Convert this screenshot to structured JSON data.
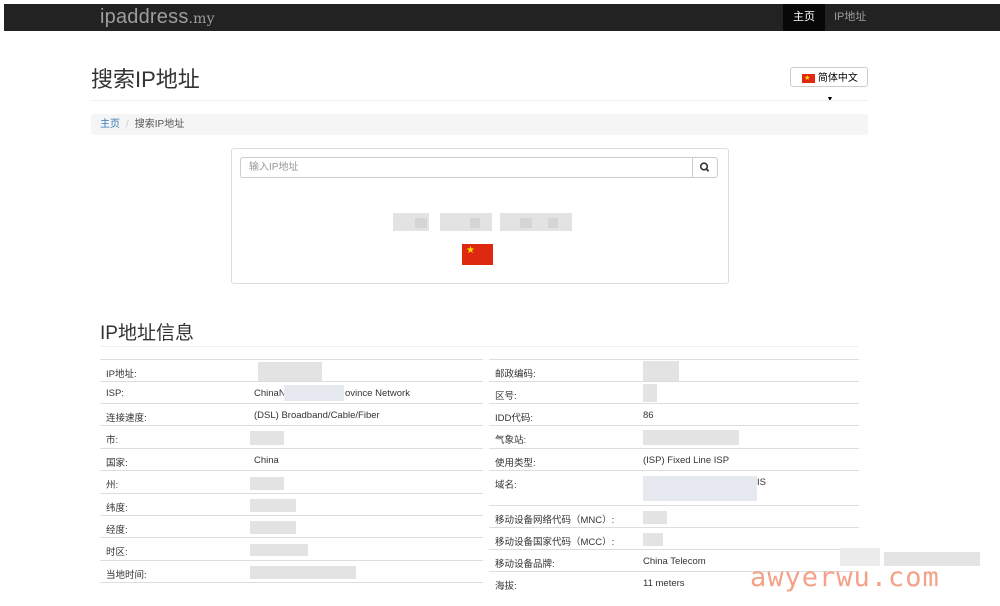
{
  "navbar": {
    "brand_name": "ipaddress",
    "brand_tld": ".my",
    "items": [
      {
        "label": "主页",
        "active": true
      },
      {
        "label": "IP地址",
        "active": false
      }
    ]
  },
  "page": {
    "title": "搜索IP地址",
    "language_button": "简体中文"
  },
  "breadcrumb": {
    "home": "主页",
    "separator": "/",
    "current": "搜索IP地址"
  },
  "search": {
    "placeholder": "输入IP地址",
    "button_icon": "search-icon"
  },
  "result": {
    "country_flag": "china-flag"
  },
  "info": {
    "title": "IP地址信息",
    "left": [
      {
        "label": "IP地址:",
        "value": ""
      },
      {
        "label": "ISP:",
        "value_start": "ChinaN",
        "value_end": "ovince Network"
      },
      {
        "label": "连接速度:",
        "value": "(DSL) Broadband/Cable/Fiber"
      },
      {
        "label": "市:",
        "value": ""
      },
      {
        "label": "国家:",
        "value": "China"
      },
      {
        "label": "州:",
        "value": ""
      },
      {
        "label": "纬度:",
        "value": ""
      },
      {
        "label": "经度:",
        "value": ""
      },
      {
        "label": "时区:",
        "value": ""
      },
      {
        "label": "当地时间:",
        "value": ""
      },
      {
        "label": "",
        "value": ""
      }
    ],
    "right": [
      {
        "label": "邮政编码:",
        "value": ""
      },
      {
        "label": "区号:",
        "value": ""
      },
      {
        "label": "IDD代码:",
        "value": "86"
      },
      {
        "label": "气象站:",
        "value": ""
      },
      {
        "label": "使用类型:",
        "value": "(ISP) Fixed Line ISP"
      },
      {
        "label": "域名:",
        "value_end": "IS"
      },
      {
        "label": "移动设备网络代码（MNC）:",
        "value": ""
      },
      {
        "label": "移动设备国家代码（MCC）:",
        "value": ""
      },
      {
        "label": "移动设备品牌:",
        "value": "China Telecom"
      },
      {
        "label": "海拔:",
        "value": "11 meters"
      }
    ]
  },
  "watermark": "awyerwu.com",
  "colors": {
    "navbar_bg": "#222222",
    "link": "#337ab7",
    "flag_red": "#de2910",
    "flag_star": "#ffde00",
    "watermark": "#f3a287"
  }
}
